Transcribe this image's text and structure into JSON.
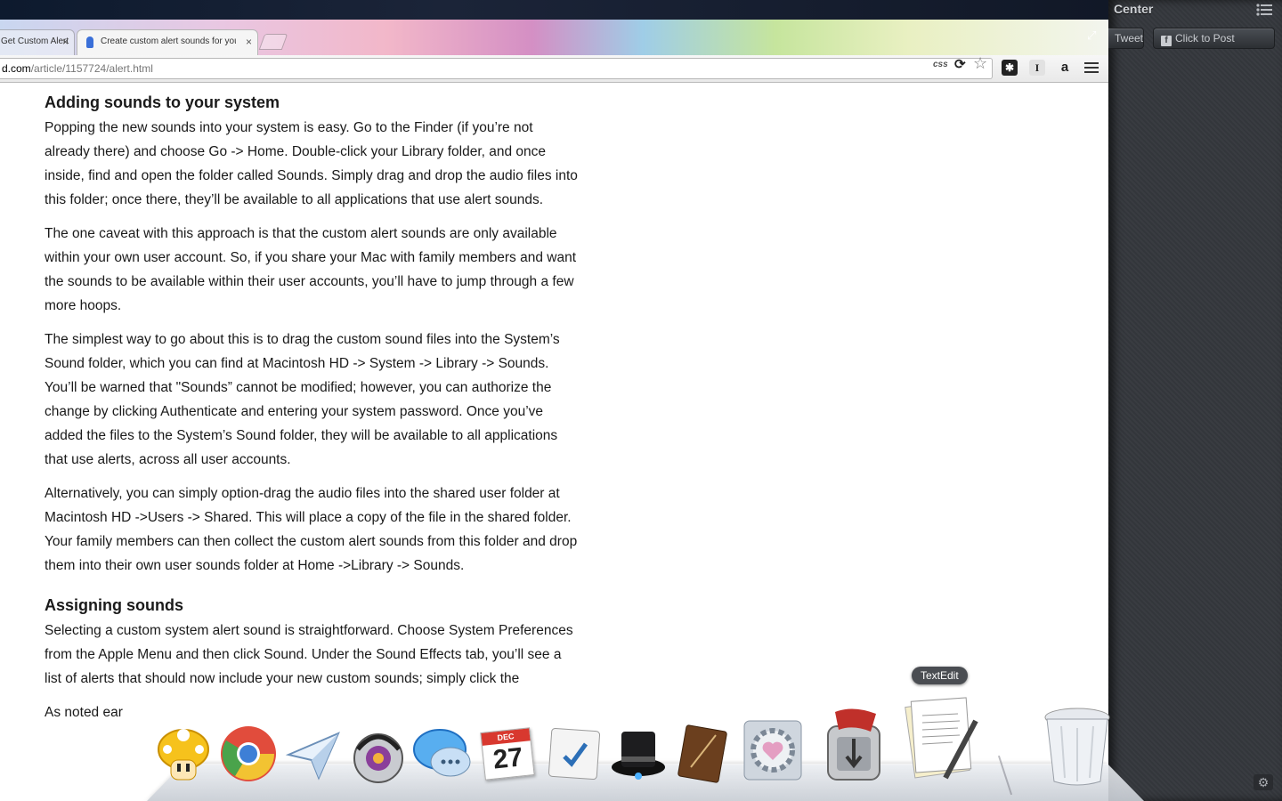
{
  "notification_center": {
    "title": "Center",
    "tweet_label": "Tweet",
    "post_label": "Click to Post"
  },
  "browser": {
    "tabs": [
      {
        "label": "Get Custom Alert",
        "active": false
      },
      {
        "label": "Create custom alert sounds for your Mac",
        "active": true
      }
    ],
    "url_host": "d.com",
    "url_path": "/article/1157724/alert.html",
    "toolbar": {
      "css_label": "css",
      "ext_icons": [
        "puzzle-ext-icon",
        "instapaper-icon",
        "amazon-icon"
      ]
    }
  },
  "article": {
    "heading1": "Adding sounds to your system",
    "p1": "Popping the new sounds into your system is easy. Go to the Finder (if you’re not already there) and choose Go -> Home. Double-click your Library folder, and once inside, find and open the folder called Sounds. Simply drag and drop the audio files into this folder; once there, they’ll be available to all applications that use alert sounds.",
    "p2": "The one caveat with this approach is that the custom alert sounds are only available within your own user account. So, if you share your Mac with family members and want the sounds to be available within their user accounts, you’ll have to jump through a few more hoops.",
    "p3": "The simplest way to go about this is to drag the custom sound files into the System’s Sound folder, which you can find at Macintosh HD -> System -> Library -> Sounds. You’ll be warned that \"Sounds” cannot be modified; however, you can authorize the change by clicking Authenticate and entering your system password. Once you’ve added the files to the System’s Sound folder, they will be available to all applications that use alerts, across all user accounts.",
    "p4": "Alternatively, you can simply option-drag the audio files into the shared user folder at Macintosh HD ->Users -> Shared. This will place a copy of the file in the shared folder. Your family members can then collect the custom alert sounds from this folder and drop them into their own user sounds folder at Home ->Library -> Sounds.",
    "heading2": "Assigning sounds",
    "p5": "Selecting a custom system alert sound is straightforward. Choose System Preferences from the Apple Menu and then click Sound. Under the Sound Effects tab, you’ll see a list of alerts that should now include your new custom sounds; simply click the",
    "p6": "As noted ear"
  },
  "dock": {
    "tooltip": "TextEdit",
    "calendar_month": "DEC",
    "calendar_day": "27",
    "items": [
      "mushroom-app-icon",
      "chrome-icon",
      "mail-send-icon",
      "itunes-icon",
      "messages-icon",
      "calendar-icon",
      "reminders-icon",
      "alfred-icon",
      "notebook-icon",
      "system-preferences-icon",
      "transmit-icon",
      "textedit-icon",
      "trash-icon"
    ]
  }
}
